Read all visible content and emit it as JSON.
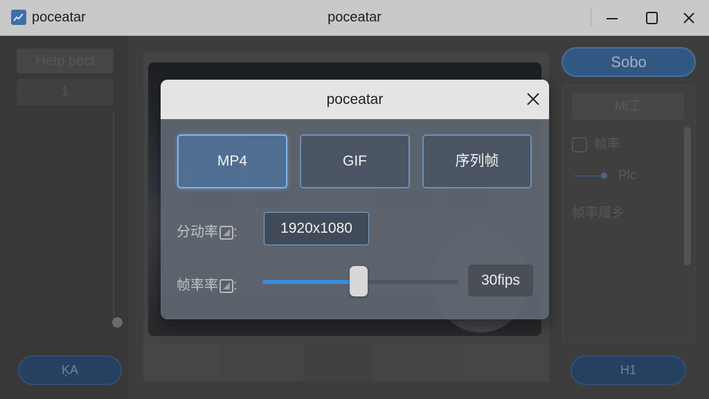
{
  "window": {
    "app_name": "poceatar",
    "title": "poceatar",
    "controls": {
      "minimize": "minimize-icon",
      "maximize": "maximize-icon",
      "close": "close-icon"
    }
  },
  "left_panel": {
    "header": "Hetp pect",
    "item": "1",
    "button": "ĶA"
  },
  "right_panel": {
    "top_button": "Sobo",
    "tab": "Mi工",
    "row1": "帧率",
    "row2": "Plc",
    "row3": "帧率履乡",
    "bottom_button": "H1"
  },
  "dialog": {
    "title": "poceatar",
    "formats": [
      "MP4",
      "GIF",
      "序列帧"
    ],
    "selected_format": "MP4",
    "resolution_label": "分动率",
    "resolution_value": "1920x1080",
    "framerate_label": "帧率率",
    "colon": ":",
    "framerate_value": "30fips",
    "framerate_slider_fraction": 0.49
  },
  "colors": {
    "accent": "#3b8be0",
    "selected_border": "#7fb4ec",
    "primary_button": "#3b6fa8"
  }
}
